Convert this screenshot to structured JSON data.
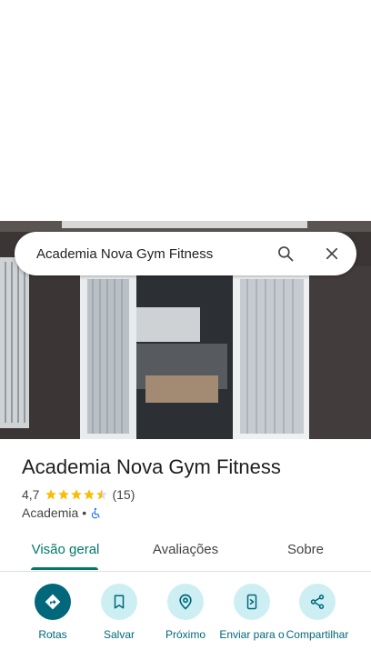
{
  "search": {
    "query": "Academia Nova Gym Fitness"
  },
  "place": {
    "name": "Academia Nova Gym Fitness",
    "rating": "4,7",
    "rating_value": 4.7,
    "review_count": "(15)",
    "category": "Academia",
    "separator": "•"
  },
  "tabs": [
    {
      "label": "Visão geral",
      "active": true
    },
    {
      "label": "Avaliações",
      "active": false
    },
    {
      "label": "Sobre",
      "active": false
    }
  ],
  "actions": [
    {
      "label": "Rotas",
      "icon": "directions-icon"
    },
    {
      "label": "Salvar",
      "icon": "bookmark-icon"
    },
    {
      "label": "Próximo",
      "icon": "nearby-icon"
    },
    {
      "label": "Enviar para o",
      "icon": "send-to-phone-icon"
    },
    {
      "label": "Compartilhar",
      "icon": "share-icon"
    }
  ],
  "colors": {
    "accent": "#00796b",
    "action_bg": "#cdeff3",
    "primary_action": "#00687a",
    "star": "#fbbc04"
  }
}
